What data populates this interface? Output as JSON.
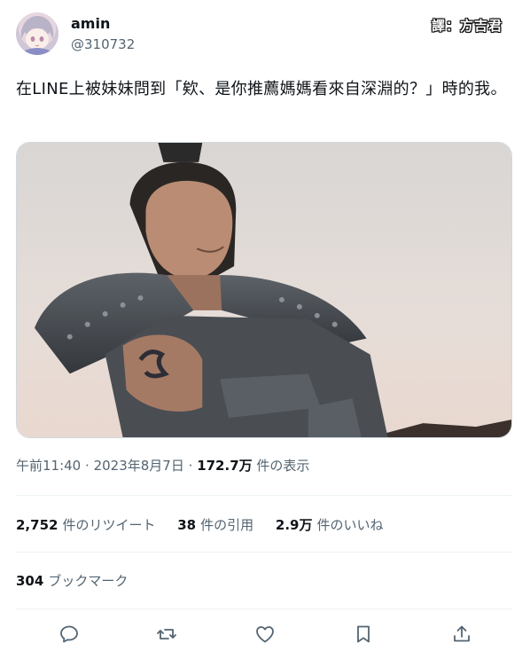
{
  "author": {
    "display_name": "amin",
    "handle": "@310732",
    "avatar_icon": "anime-avatar"
  },
  "watermark": "譯：方吉君",
  "tweet": {
    "text": "在LINE上被妹妹問到「欸、是你推薦媽媽看來自深淵的？」時的我。"
  },
  "meta": {
    "time": "午前11:40",
    "separator": "·",
    "date": "2023年8月7日",
    "views_count": "172.7万",
    "views_label": "件の表示"
  },
  "stats": {
    "retweets_count": "2,752",
    "retweets_label": "件のリツイート",
    "quotes_count": "38",
    "quotes_label": "件の引用",
    "likes_count": "2.9万",
    "likes_label": "件のいいね"
  },
  "bookmarks": {
    "count": "304",
    "label": "ブックマーク"
  },
  "actions": [
    "reply-icon",
    "retweet-icon",
    "like-icon",
    "bookmark-icon",
    "share-icon"
  ],
  "colors": {
    "text": "#0f1419",
    "secondary": "#536471",
    "divider": "#eff3f4"
  }
}
